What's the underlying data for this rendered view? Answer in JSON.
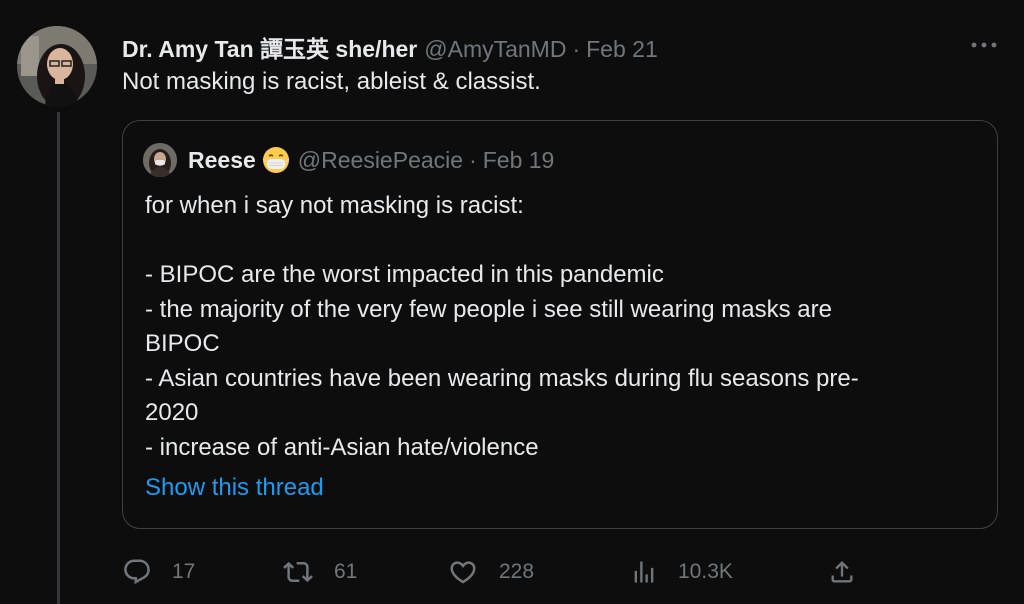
{
  "tweet": {
    "author_name": "Dr. Amy Tan 譚玉英 she/her",
    "handle": "@AmyTanMD",
    "separator": "·",
    "date": "Feb 21",
    "more_label": "···",
    "text": "Not masking is racist, ableist & classist."
  },
  "quote": {
    "author_name": "Reese",
    "emoji": "mask-face-emoji",
    "handle": "@ReesiePeacie",
    "separator": "·",
    "date": "Feb 19",
    "lines": [
      "for when i say not masking is racist:",
      "",
      "- BIPOC are the worst impacted in this pandemic",
      "- the majority of the very few people i see still wearing masks are",
      "BIPOC",
      "- Asian countries have been wearing masks during flu seasons pre-",
      "2020",
      "- increase of anti-Asian hate/violence"
    ],
    "show_thread": "Show this thread"
  },
  "actions": {
    "replies": "17",
    "retweets": "61",
    "likes": "228",
    "views": "10.3K"
  },
  "colors": {
    "background": "#0d0d0d",
    "text": "#e7e9ea",
    "secondary": "#71767b",
    "link": "#1d9bf0",
    "border": "#3e4144"
  },
  "icons": {
    "reply": "reply-icon",
    "retweet": "retweet-icon",
    "like": "heart-icon",
    "views": "views-icon",
    "share": "share-icon",
    "more": "more-dots-icon"
  }
}
